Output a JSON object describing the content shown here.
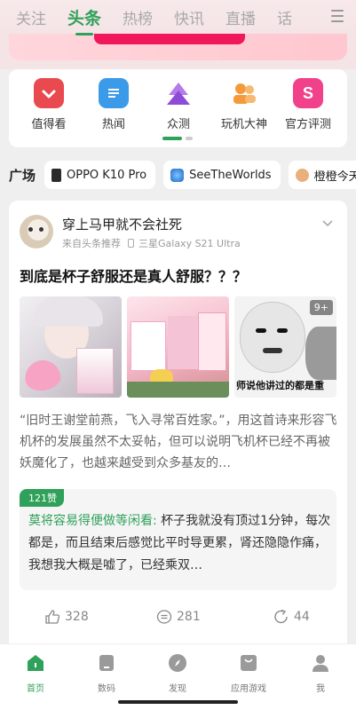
{
  "top_tabs": [
    "关注",
    "头条",
    "热榜",
    "快讯",
    "直播",
    "话"
  ],
  "active_tab_index": 1,
  "shortcuts": [
    {
      "label": "值得看",
      "icon": "check-shield-icon",
      "color": "#e84a4f"
    },
    {
      "label": "热闻",
      "icon": "document-icon",
      "color": "#3c9be8"
    },
    {
      "label": "众测",
      "icon": "triangle-stack-icon",
      "color": "#9b5de5"
    },
    {
      "label": "玩机大神",
      "icon": "people-icon",
      "color": "#f59a3a"
    },
    {
      "label": "官方评测",
      "icon": "s-badge-icon",
      "color": "#f0418a"
    }
  ],
  "square": {
    "title": "广场",
    "chips": [
      {
        "label": "OPPO K10 Pro",
        "icon": "phone-icon",
        "color": "#333333"
      },
      {
        "label": "SeeTheWorlds",
        "icon": "planet-icon",
        "color": "#1e6ac8"
      },
      {
        "label": "橙橙今天",
        "icon": "avatar-icon",
        "color": "#e8b07a"
      }
    ]
  },
  "post": {
    "author": "穿上马甲就不会社死",
    "source": "来自头条推荐",
    "device": "三星Galaxy S21 Ultra",
    "title": "到底是杯子舒服还是真人舒服？？？",
    "more_images": "9+",
    "meme_caption": "师说他讲过的都是重",
    "excerpt": "“旧时王谢堂前燕，飞入寻常百姓家。”，用这首诗来形容飞机杯的发展虽然不太妥帖，但可以说明飞机杯已经不再被妖魔化了，也越来越受到众多基友的…",
    "hot_comment": {
      "likes": "121赞",
      "commenter": "莫将容易得便做等闲看:",
      "text": " 杯子我就没有顶过1分钟，每次都是，而且结束后感觉比平时导更累，肾还隐隐作痛，我想我大概是嘘了，已经乘双…"
    },
    "actions": {
      "likes": "328",
      "comments": "281",
      "shares": "44"
    }
  },
  "bottom_nav": [
    {
      "label": "首页",
      "icon": "home-icon",
      "active": true
    },
    {
      "label": "数码",
      "icon": "device-icon",
      "active": false
    },
    {
      "label": "发现",
      "icon": "compass-icon",
      "active": false
    },
    {
      "label": "应用游戏",
      "icon": "app-store-icon",
      "active": false
    },
    {
      "label": "我",
      "icon": "profile-icon",
      "active": false
    }
  ],
  "colors": {
    "accent": "#2fa15a"
  }
}
